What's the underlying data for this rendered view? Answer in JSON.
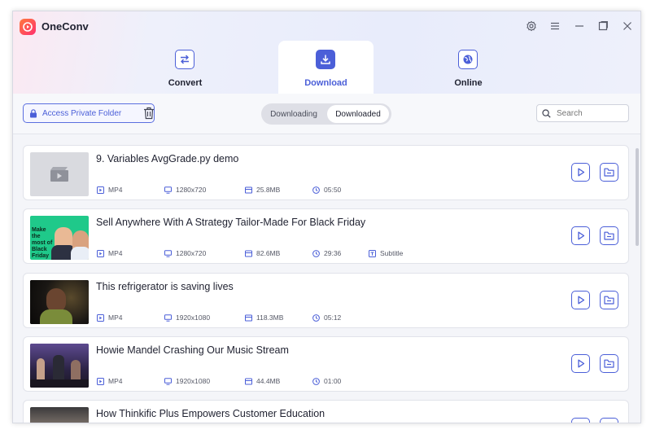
{
  "app": {
    "title": "OneConv"
  },
  "tabs": [
    {
      "label": "Convert",
      "icon": "convert-arrows-icon"
    },
    {
      "label": "Download",
      "icon": "download-icon",
      "active": true
    },
    {
      "label": "Online",
      "icon": "globe-icon"
    }
  ],
  "toolbar": {
    "private_folder_label": "Access Private Folder",
    "segments": [
      "Downloading",
      "Downloaded"
    ],
    "active_segment": "Downloaded",
    "search_placeholder": "Search"
  },
  "colors": {
    "accent": "#4b5fd8",
    "brand_gradient_start": "#ff7a3d",
    "brand_gradient_end": "#ff2f6e"
  },
  "downloads": [
    {
      "title": "9. Variables AvgGrade.py demo",
      "format": "MP4",
      "resolution": "1280x720",
      "size": "25.8MB",
      "duration": "05:50",
      "subtitle": ""
    },
    {
      "title": "Sell Anywhere With A Strategy Tailor-Made For Black Friday",
      "format": "MP4",
      "resolution": "1280x720",
      "size": "82.6MB",
      "duration": "29:36",
      "subtitle": "Subtitle",
      "thumb_text": "Make the most of Black Friday"
    },
    {
      "title": "This refrigerator is saving lives",
      "format": "MP4",
      "resolution": "1920x1080",
      "size": "118.3MB",
      "duration": "05:12",
      "subtitle": ""
    },
    {
      "title": "Howie Mandel Crashing Our Music Stream",
      "format": "MP4",
      "resolution": "1920x1080",
      "size": "44.4MB",
      "duration": "01:00",
      "subtitle": ""
    },
    {
      "title": "How Thinkific Plus Empowers Customer Education",
      "format": "",
      "resolution": "",
      "size": "",
      "duration": "",
      "subtitle": ""
    }
  ]
}
